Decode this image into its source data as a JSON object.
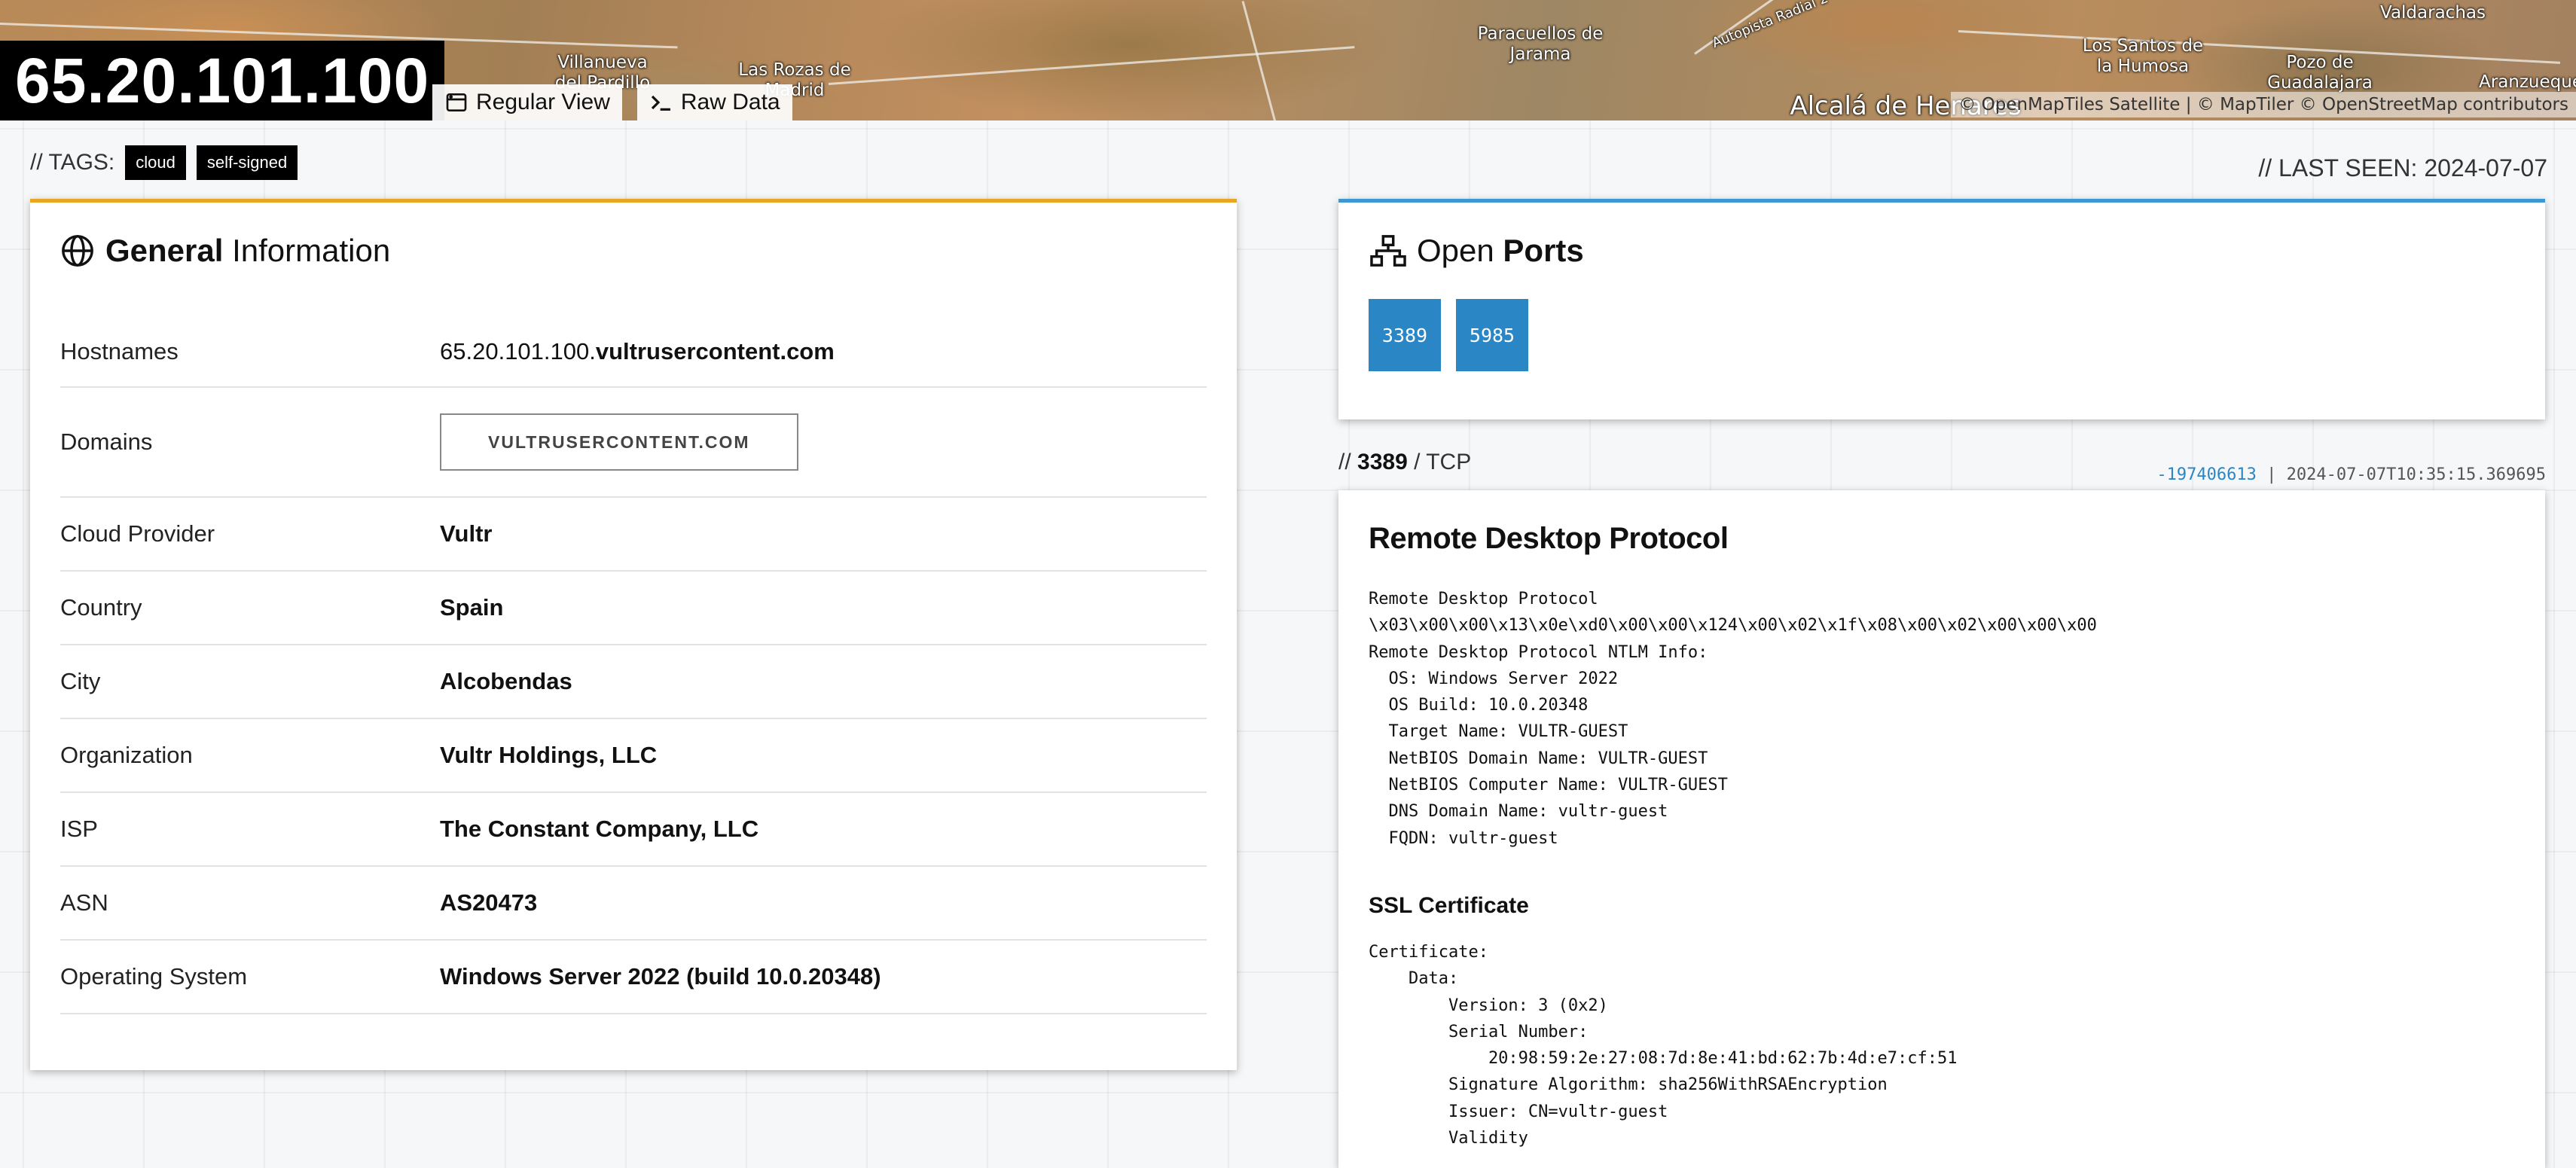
{
  "map": {
    "labels": [
      "Villanueva del Pardillo",
      "Las Rozas de Madrid",
      "Paracuellos de Jarama",
      "Autopista Radial 2",
      "Los Santos de la Humosa",
      "Pozo de Guadalajara",
      "Valdarachas",
      "Aranzueque",
      "Alcalá de Henares"
    ],
    "attribution": "© OpenMapTiles Satellite | © MapTiler © OpenStreetMap contributors"
  },
  "host": {
    "ip": "65.20.101.100",
    "views": [
      "Regular View",
      "Raw Data"
    ]
  },
  "tags": {
    "prefix": "// TAGS:",
    "items": [
      "cloud",
      "self-signed"
    ]
  },
  "last_seen": "// LAST SEEN: 2024-07-07",
  "general": {
    "title_bold": "General",
    "title_light": " Information",
    "rows": [
      {
        "label": "Hostnames",
        "value_light": "65.20.101.100.",
        "value": "vultrusercontent.com"
      },
      {
        "label": "Domains",
        "value": "VULTRUSERCONTENT.COM"
      },
      {
        "label": "Cloud Provider",
        "value": "Vultr"
      },
      {
        "label": "Country",
        "value": "Spain"
      },
      {
        "label": "City",
        "value": "Alcobendas"
      },
      {
        "label": "Organization",
        "value": "Vultr Holdings, LLC"
      },
      {
        "label": "ISP",
        "value": "The Constant Company, LLC"
      },
      {
        "label": "ASN",
        "value": "AS20473"
      },
      {
        "label": "Operating System",
        "value": "Windows Server 2022 (build 10.0.20348)"
      }
    ]
  },
  "ports": {
    "title_light": "Open ",
    "title_bold": "Ports",
    "items": [
      "3389",
      "5985"
    ]
  },
  "service": {
    "prefix": "// ",
    "port": "3389",
    "proto": " / TCP",
    "hash": "-197406613",
    "separator": " | ",
    "timestamp": "2024-07-07T10:35:15.369695",
    "title": "Remote Desktop Protocol",
    "banner": "Remote Desktop Protocol\n\\x03\\x00\\x00\\x13\\x0e\\xd0\\x00\\x00\\x124\\x00\\x02\\x1f\\x08\\x00\\x02\\x00\\x00\\x00\nRemote Desktop Protocol NTLM Info:\n  OS: Windows Server 2022\n  OS Build: 10.0.20348\n  Target Name: VULTR-GUEST\n  NetBIOS Domain Name: VULTR-GUEST\n  NetBIOS Computer Name: VULTR-GUEST\n  DNS Domain Name: vultr-guest\n  FQDN: vultr-guest",
    "ssl_title": "SSL Certificate",
    "cert": "Certificate:\n    Data:\n        Version: 3 (0x2)\n        Serial Number:\n            20:98:59:2e:27:08:7d:8e:41:bd:62:7b:4d:e7:cf:51\n        Signature Algorithm: sha256WithRSAEncryption\n        Issuer: CN=vultr-guest\n        Validity"
  }
}
